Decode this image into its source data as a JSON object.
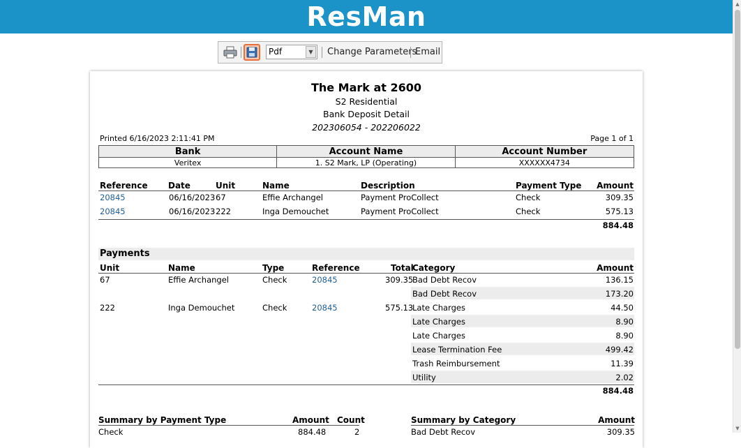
{
  "header": {
    "logo_text": "ResMan"
  },
  "toolbar": {
    "export_format": "Pdf",
    "change_parameters_label": "Change Parameters",
    "email_label": "Email"
  },
  "report": {
    "property_name": "The Mark at 2600",
    "company": "S2 Residential",
    "report_name": "Bank Deposit Detail",
    "batch_range": "202306054 - 202206022",
    "printed": "Printed 6/16/2023 2:11:41 PM",
    "page": "Page 1 of 1",
    "bank_table": {
      "headers": [
        "Bank",
        "Account Name",
        "Account Number"
      ],
      "values": [
        "Veritex",
        "1. S2 Mark, LP (Operating)",
        "XXXXXX4734"
      ]
    },
    "deposits": {
      "headers": {
        "reference": "Reference",
        "date": "Date",
        "unit": "Unit",
        "name": "Name",
        "description": "Description",
        "payment_type": "Payment Type",
        "amount": "Amount"
      },
      "rows": [
        {
          "reference": "20845",
          "date": "06/16/2023",
          "unit": "67",
          "name": "Effie Archangel",
          "description": "Payment ProCollect",
          "payment_type": "Check",
          "amount": "309.35"
        },
        {
          "reference": "20845",
          "date": "06/16/2023",
          "unit": "222",
          "name": "Inga Demouchet",
          "description": "Payment ProCollect",
          "payment_type": "Check",
          "amount": "575.13"
        }
      ],
      "total": "884.48"
    },
    "payments": {
      "section_title": "Payments",
      "headers": {
        "unit": "Unit",
        "name": "Name",
        "type": "Type",
        "reference": "Reference",
        "total": "Total",
        "category": "Category",
        "amount": "Amount"
      },
      "groups": [
        {
          "unit": "67",
          "name": "Effie Archangel",
          "type": "Check",
          "reference": "20845",
          "total": "309.35",
          "lines": [
            {
              "category": "Bad Debt Recov",
              "amount": "136.15"
            },
            {
              "category": "Bad Debt Recov",
              "amount": "173.20"
            }
          ]
        },
        {
          "unit": "222",
          "name": "Inga Demouchet",
          "type": "Check",
          "reference": "20845",
          "total": "575.13",
          "lines": [
            {
              "category": "Late Charges",
              "amount": "44.50"
            },
            {
              "category": "Late Charges",
              "amount": "8.90"
            },
            {
              "category": "Late Charges",
              "amount": "8.90"
            },
            {
              "category": "Lease Termination Fee",
              "amount": "499.42"
            },
            {
              "category": "Trash Reimbursement",
              "amount": "11.39"
            },
            {
              "category": "Utility",
              "amount": "2.02"
            }
          ]
        }
      ],
      "total": "884.48"
    },
    "summary_payment_type": {
      "title": "Summary by Payment Type",
      "amount_header": "Amount",
      "count_header": "Count",
      "rows": [
        {
          "type": "Check",
          "amount": "884.48",
          "count": "2"
        }
      ]
    },
    "summary_category": {
      "title": "Summary by Category",
      "amount_header": "Amount",
      "rows": [
        {
          "category": "Bad Debt Recov",
          "amount": "309.35"
        }
      ]
    }
  }
}
